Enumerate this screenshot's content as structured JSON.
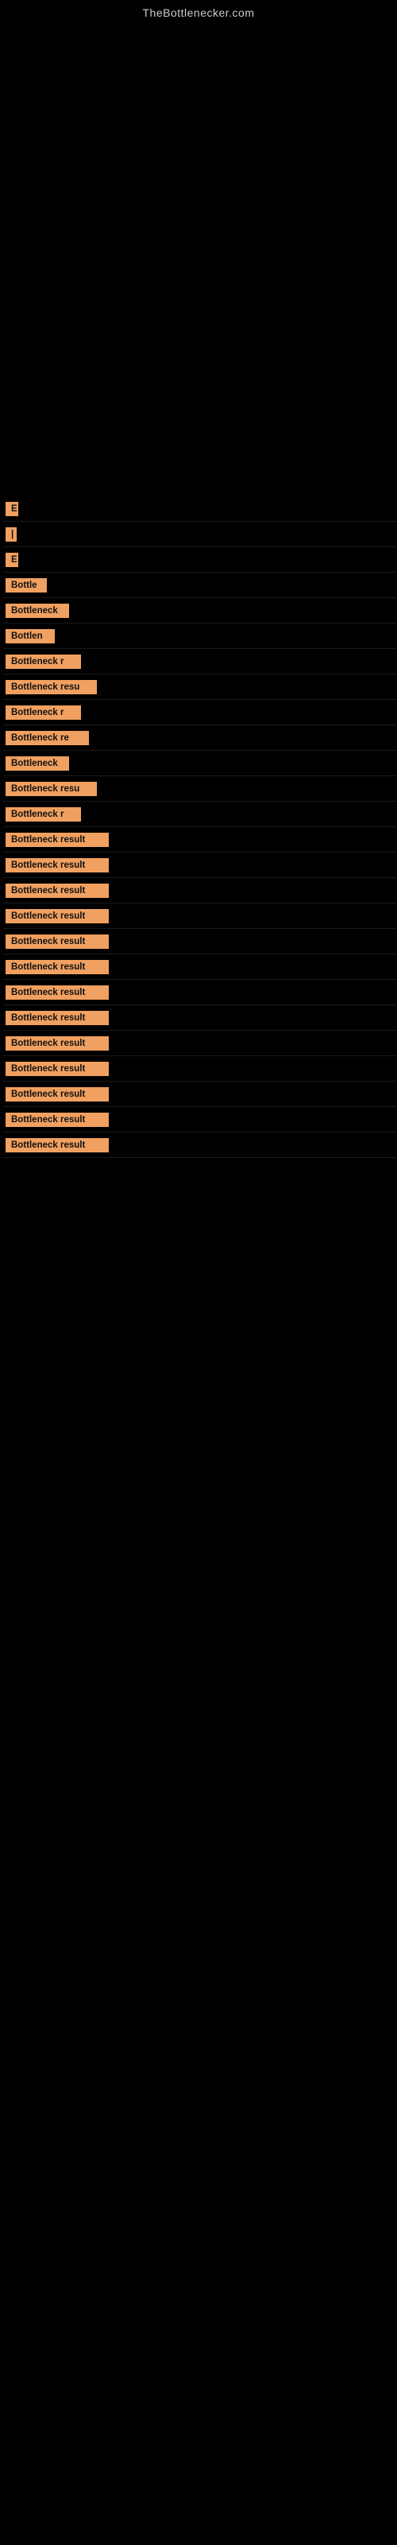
{
  "site": {
    "title": "TheBottlenecker.com"
  },
  "items": [
    {
      "id": 1,
      "label": "E",
      "chipWidth": 16
    },
    {
      "id": 2,
      "label": "|",
      "chipWidth": 10
    },
    {
      "id": 3,
      "label": "E",
      "chipWidth": 16
    },
    {
      "id": 4,
      "label": "Bottle",
      "chipWidth": 52
    },
    {
      "id": 5,
      "label": "Bottleneck",
      "chipWidth": 80
    },
    {
      "id": 6,
      "label": "Bottlen",
      "chipWidth": 62
    },
    {
      "id": 7,
      "label": "Bottleneck r",
      "chipWidth": 95
    },
    {
      "id": 8,
      "label": "Bottleneck resu",
      "chipWidth": 115
    },
    {
      "id": 9,
      "label": "Bottleneck r",
      "chipWidth": 95
    },
    {
      "id": 10,
      "label": "Bottleneck re",
      "chipWidth": 105
    },
    {
      "id": 11,
      "label": "Bottleneck",
      "chipWidth": 80
    },
    {
      "id": 12,
      "label": "Bottleneck resu",
      "chipWidth": 115
    },
    {
      "id": 13,
      "label": "Bottleneck r",
      "chipWidth": 95
    },
    {
      "id": 14,
      "label": "Bottleneck result",
      "chipWidth": 130
    },
    {
      "id": 15,
      "label": "Bottleneck result",
      "chipWidth": 130
    },
    {
      "id": 16,
      "label": "Bottleneck result",
      "chipWidth": 130
    },
    {
      "id": 17,
      "label": "Bottleneck result",
      "chipWidth": 130
    },
    {
      "id": 18,
      "label": "Bottleneck result",
      "chipWidth": 130
    },
    {
      "id": 19,
      "label": "Bottleneck result",
      "chipWidth": 130
    },
    {
      "id": 20,
      "label": "Bottleneck result",
      "chipWidth": 130
    },
    {
      "id": 21,
      "label": "Bottleneck result",
      "chipWidth": 130
    },
    {
      "id": 22,
      "label": "Bottleneck result",
      "chipWidth": 130
    },
    {
      "id": 23,
      "label": "Bottleneck result",
      "chipWidth": 130
    },
    {
      "id": 24,
      "label": "Bottleneck result",
      "chipWidth": 130
    },
    {
      "id": 25,
      "label": "Bottleneck result",
      "chipWidth": 130
    },
    {
      "id": 26,
      "label": "Bottleneck result",
      "chipWidth": 130
    }
  ]
}
